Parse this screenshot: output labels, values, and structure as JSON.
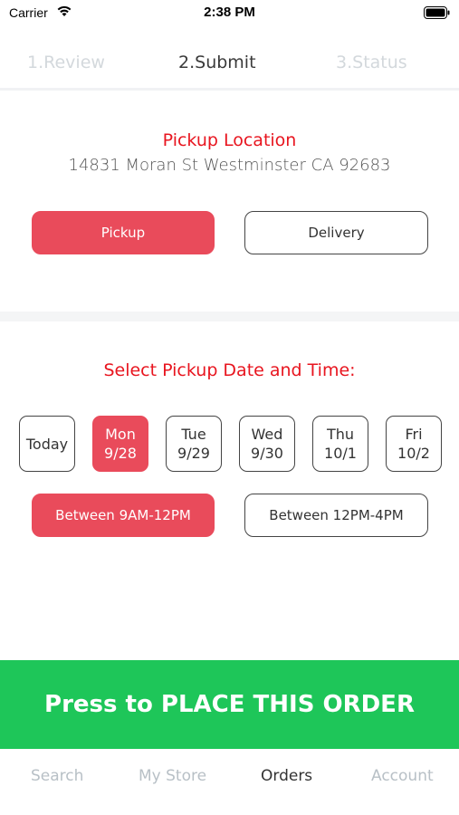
{
  "status_bar": {
    "carrier": "Carrier",
    "time": "2:38 PM"
  },
  "steps": [
    {
      "label": "1.Review",
      "active": false
    },
    {
      "label": "2.Submit",
      "active": true
    },
    {
      "label": "3.Status",
      "active": false
    }
  ],
  "pickup_location": {
    "title": "Pickup Location",
    "address": "14831 Moran St Westminster CA 92683"
  },
  "fulfillment": {
    "options": [
      "Pickup",
      "Delivery"
    ],
    "selected": "Pickup"
  },
  "schedule": {
    "title": "Select Pickup Date and Time:",
    "days": [
      {
        "line1": "Today",
        "line2": ""
      },
      {
        "line1": "Mon",
        "line2": "9/28"
      },
      {
        "line1": "Tue",
        "line2": "9/29"
      },
      {
        "line1": "Wed",
        "line2": "9/30"
      },
      {
        "line1": "Thu",
        "line2": "10/1"
      },
      {
        "line1": "Fri",
        "line2": "10/2"
      }
    ],
    "selected_day": "Mon 9/28",
    "time_slots": [
      "Between 9AM-12PM",
      "Between 12PM-4PM"
    ],
    "selected_time_slot": "Between 9AM-12PM"
  },
  "place_order_label": "Press to PLACE THIS ORDER",
  "tab_bar": {
    "items": [
      "Search",
      "My Store",
      "Orders",
      "Account"
    ],
    "active": "Orders"
  },
  "colors": {
    "accent_red": "#e94b5b",
    "title_red": "#e8151f",
    "order_green": "#1ec659",
    "inactive_gray": "#b8c0c6"
  },
  "icons": [
    "wifi-icon",
    "battery-icon"
  ]
}
